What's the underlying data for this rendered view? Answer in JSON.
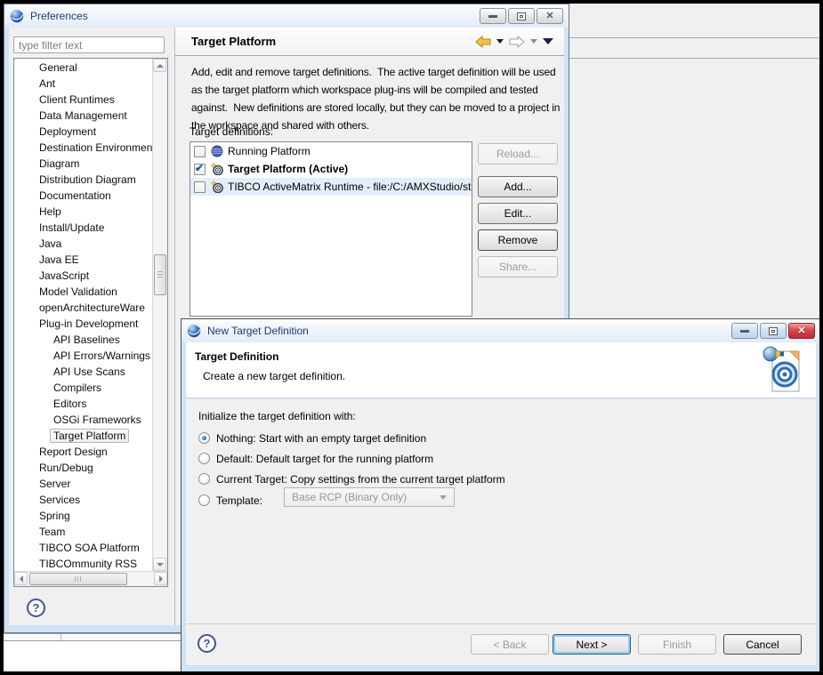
{
  "glyphs": {
    "close": "✕",
    "check": "✔",
    "help": "?"
  },
  "preferences": {
    "title": "Preferences",
    "filter_placeholder": "type filter text",
    "tree": [
      {
        "label": "General",
        "level": 1
      },
      {
        "label": "Ant",
        "level": 1
      },
      {
        "label": "Client Runtimes",
        "level": 1
      },
      {
        "label": "Data Management",
        "level": 1
      },
      {
        "label": "Deployment",
        "level": 1
      },
      {
        "label": "Destination Environmen",
        "level": 1
      },
      {
        "label": "Diagram",
        "level": 1
      },
      {
        "label": "Distribution Diagram",
        "level": 1
      },
      {
        "label": "Documentation",
        "level": 1
      },
      {
        "label": "Help",
        "level": 1
      },
      {
        "label": "Install/Update",
        "level": 1
      },
      {
        "label": "Java",
        "level": 1
      },
      {
        "label": "Java EE",
        "level": 1
      },
      {
        "label": "JavaScript",
        "level": 1
      },
      {
        "label": "Model Validation",
        "level": 1
      },
      {
        "label": "openArchitectureWare",
        "level": 1
      },
      {
        "label": "Plug-in Development",
        "level": 1
      },
      {
        "label": "API Baselines",
        "level": 2
      },
      {
        "label": "API Errors/Warnings",
        "level": 2
      },
      {
        "label": "API Use Scans",
        "level": 2
      },
      {
        "label": "Compilers",
        "level": 2
      },
      {
        "label": "Editors",
        "level": 2
      },
      {
        "label": "OSGi Frameworks",
        "level": 2
      },
      {
        "label": "Target Platform",
        "level": 2,
        "selected": true
      },
      {
        "label": "Report Design",
        "level": 1
      },
      {
        "label": "Run/Debug",
        "level": 1
      },
      {
        "label": "Server",
        "level": 1
      },
      {
        "label": "Services",
        "level": 1
      },
      {
        "label": "Spring",
        "level": 1
      },
      {
        "label": "Team",
        "level": 1
      },
      {
        "label": "TIBCO SOA Platform",
        "level": 1
      },
      {
        "label": "TIBCOmmunity RSS",
        "level": 1
      }
    ],
    "page": {
      "title": "Target Platform",
      "description": "Add, edit and remove target definitions.  The active target definition will be used as the target platform which workspace plug-ins will be compiled and tested against.  New definitions are stored locally, but they can be moved to a project in the workspace and shared with others.",
      "list_label": "Target definitions:",
      "targets": [
        {
          "label": "Running Platform",
          "checked": false,
          "active": false
        },
        {
          "label": "Target Platform (Active)",
          "checked": true,
          "active": true
        },
        {
          "label": "TIBCO ActiveMatrix Runtime - file:/C:/AMXStudio/st",
          "checked": false,
          "active": false
        }
      ],
      "actions": [
        {
          "label": "Reload...",
          "enabled": false
        },
        {
          "label": "Add...",
          "enabled": true
        },
        {
          "label": "Edit...",
          "enabled": true
        },
        {
          "label": "Remove",
          "enabled": true
        },
        {
          "label": "Share...",
          "enabled": false
        }
      ]
    },
    "colors": {
      "title_text": "#1c3a7a",
      "selection": "#e2eefb",
      "frame": "#cfe3f5"
    }
  },
  "wizard": {
    "title": "New Target Definition",
    "header": {
      "title": "Target Definition",
      "description": "Create a new target definition."
    },
    "form": {
      "group_label": "Initialize the target definition with:",
      "options": [
        {
          "label": "Nothing: Start with an empty target definition",
          "selected": true
        },
        {
          "label": "Default: Default target for the running platform",
          "selected": false
        },
        {
          "label": "Current Target: Copy settings from the current target platform",
          "selected": false
        },
        {
          "label": "Template:",
          "selected": false
        }
      ],
      "template_value": "Base RCP (Binary Only)"
    },
    "buttons": [
      {
        "label": "< Back",
        "enabled": false
      },
      {
        "label": "Next >",
        "enabled": true,
        "default": true
      },
      {
        "label": "Finish",
        "enabled": false
      },
      {
        "label": "Cancel",
        "enabled": true
      }
    ]
  }
}
